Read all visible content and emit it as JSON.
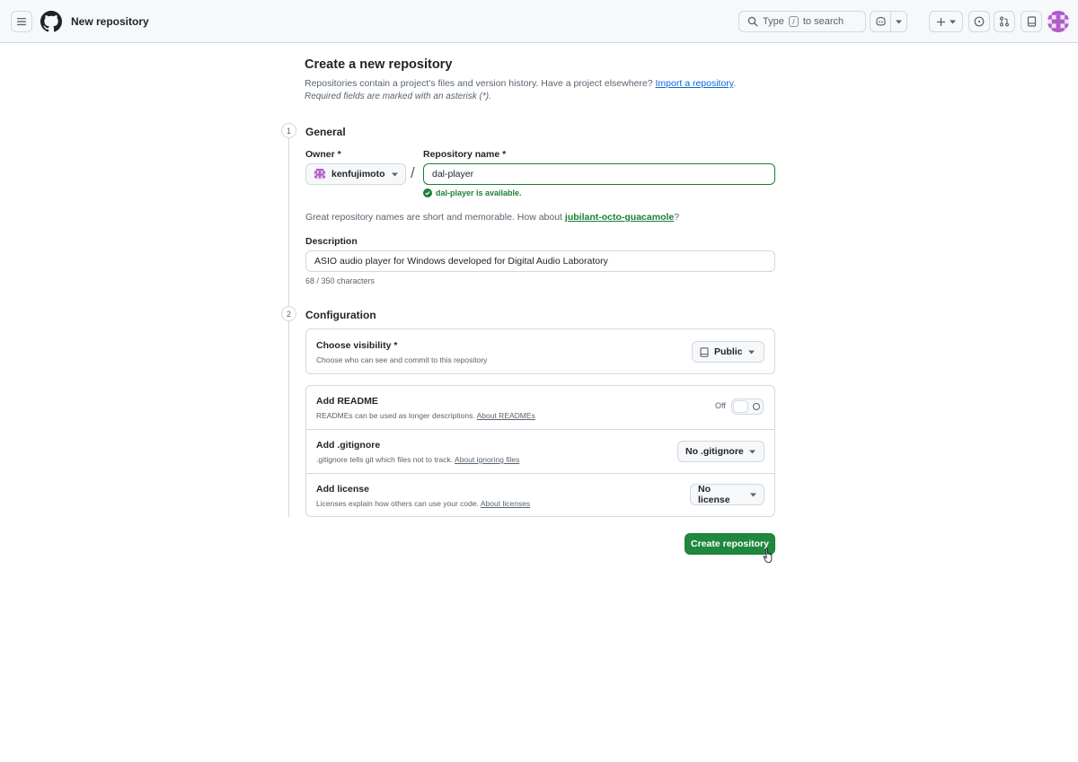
{
  "header": {
    "title": "New repository",
    "search_placeholder_prefix": "Type",
    "search_key": "/",
    "search_placeholder_suffix": "to search"
  },
  "page": {
    "heading": "Create a new repository",
    "lead": "Repositories contain a project's files and version history. Have a project elsewhere?",
    "import_link": "Import a repository",
    "lead_end": ".",
    "required_note": "Required fields are marked with an asterisk (*)."
  },
  "general": {
    "step": "1",
    "title": "General",
    "owner_label": "Owner *",
    "owner_value": "kenfujimoto",
    "separator": "/",
    "repo_label": "Repository name *",
    "repo_value": "dal-player",
    "availability": "dal-player is available.",
    "suggestion_prefix": "Great repository names are short and memorable. How about",
    "suggestion_name": "jubilant-octo-guacamole",
    "suggestion_suffix": "?",
    "description_label": "Description",
    "description_value": "ASIO audio player for Windows developed for Digital Audio Laboratory",
    "char_count": "68 / 350 characters"
  },
  "configuration": {
    "step": "2",
    "title": "Configuration",
    "visibility": {
      "title": "Choose visibility *",
      "desc": "Choose who can see and commit to this repository",
      "value": "Public"
    },
    "readme": {
      "title": "Add README",
      "desc": "READMEs can be used as longer descriptions.",
      "link": "About READMEs",
      "toggle_label": "Off"
    },
    "gitignore": {
      "title": "Add .gitignore",
      "desc": ".gitignore tells git which files not to track.",
      "link": "About ignoring files",
      "value": "No .gitignore"
    },
    "license": {
      "title": "Add license",
      "desc": "Licenses explain how others can use your code.",
      "link": "About licenses",
      "value": "No license"
    }
  },
  "actions": {
    "create_label": "Create repository"
  },
  "colors": {
    "primary_button": "#1f883d",
    "success": "#1a7f37",
    "link": "#0969da",
    "avatar": "#b05cc8"
  }
}
